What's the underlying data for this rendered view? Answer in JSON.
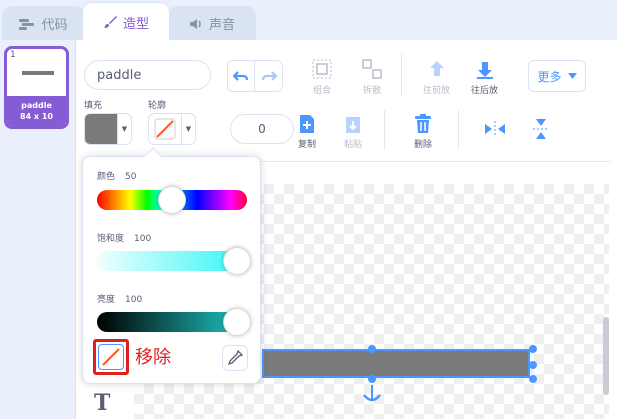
{
  "tabs": [
    {
      "label": "代码",
      "icon": "code-icon"
    },
    {
      "label": "造型",
      "icon": "brush-icon"
    },
    {
      "label": "声音",
      "icon": "speaker-icon"
    }
  ],
  "costume": {
    "number": "1",
    "name": "paddle",
    "size": "84 x 10"
  },
  "editor": {
    "name_value": "paddle",
    "tools": {
      "group": "组合",
      "ungroup": "拆散",
      "forward": "往前放",
      "backward": "往后放",
      "more": "更多",
      "copy": "复制",
      "paste": "粘贴",
      "delete": "删除"
    },
    "fill_label": "填充",
    "outline_label": "轮廓",
    "fill_color": "#7a7a7a",
    "outline_width": "0"
  },
  "color_picker": {
    "hue_label": "颜色",
    "hue_value": "50",
    "saturation_label": "饱和度",
    "saturation_value": "100",
    "brightness_label": "亮度",
    "brightness_value": "100",
    "hue_fraction": 0.5,
    "saturation_fraction": 1.0,
    "brightness_fraction": 1.0,
    "remove_label": "移除"
  },
  "colors": {
    "accent": "#855cd6",
    "blue": "#4c97ff",
    "highlight": "#e02020"
  }
}
